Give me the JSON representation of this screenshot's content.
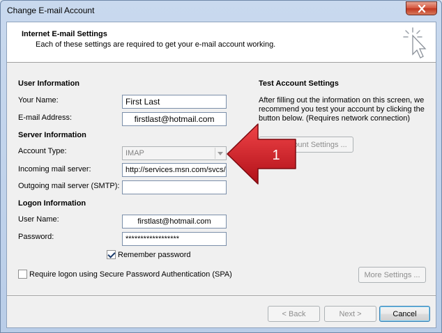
{
  "window": {
    "title": "Change E-mail Account"
  },
  "header": {
    "title": "Internet E-mail Settings",
    "subtitle": "Each of these settings are required to get your e-mail account working."
  },
  "user_info": {
    "section": "User Information",
    "your_name_label": "Your Name:",
    "your_name_value": "First Last",
    "email_label": "E-mail Address:",
    "email_value": "firstlast@hotmail.com"
  },
  "server_info": {
    "section": "Server Information",
    "account_type_label": "Account Type:",
    "account_type_value": "IMAP",
    "incoming_label": "Incoming mail server:",
    "incoming_value": "http://services.msn.com/svcs/",
    "outgoing_label": "Outgoing mail server (SMTP):",
    "outgoing_value": ""
  },
  "logon_info": {
    "section": "Logon Information",
    "username_label": "User Name:",
    "username_value": "firstlast@hotmail.com",
    "password_label": "Password:",
    "password_value": "******************",
    "remember_label": "Remember password",
    "remember_checked": true,
    "spa_label": "Require logon using Secure Password Authentication (SPA)",
    "spa_checked": false
  },
  "test_settings": {
    "section": "Test Account Settings",
    "description": "After filling out the information on this screen, we recommend you test your account by clicking the button below. (Requires network connection)",
    "button_label": "Test Account Settings ..."
  },
  "annotation": {
    "number": "1"
  },
  "buttons": {
    "more_settings": "More Settings ...",
    "back": "< Back",
    "next": "Next >",
    "cancel": "Cancel"
  },
  "colors": {
    "annotation_arrow": "#e0202a"
  }
}
